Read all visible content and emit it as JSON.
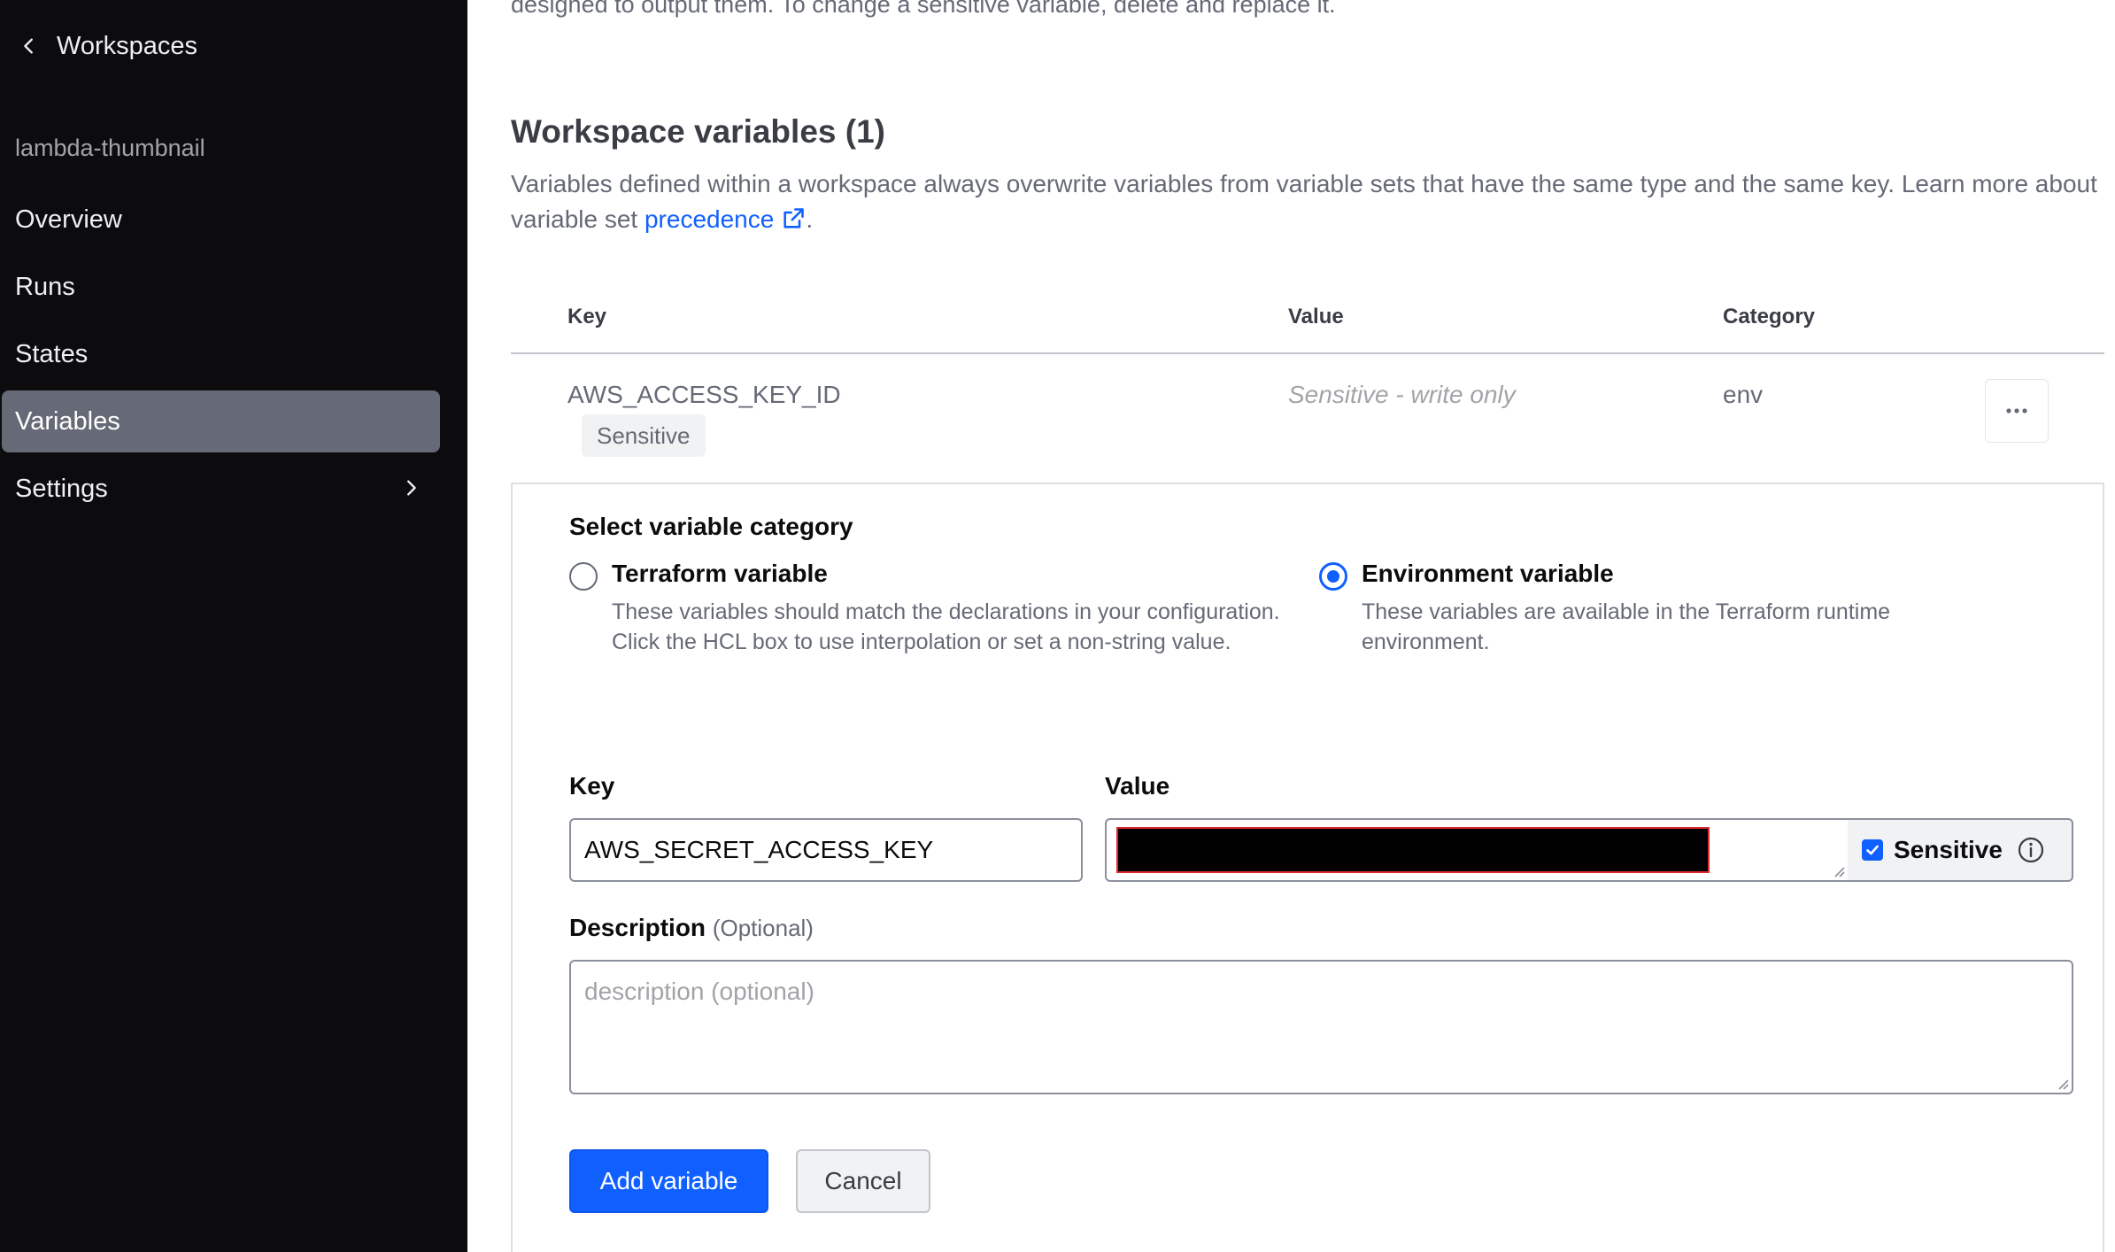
{
  "sidebar": {
    "back_label": "Workspaces",
    "workspace_name": "lambda-thumbnail",
    "items": [
      {
        "label": "Overview"
      },
      {
        "label": "Runs"
      },
      {
        "label": "States"
      },
      {
        "label": "Variables"
      },
      {
        "label": "Settings"
      }
    ],
    "active_item": "Variables"
  },
  "main": {
    "top_text": "designed to output them. To change a sensitive variable, delete and replace it.",
    "section_title": "Workspace variables (1)",
    "section_desc": "Variables defined within a workspace always overwrite variables from variable sets that have the same type and the same key. Learn more about variable set ",
    "precedence_link": "precedence",
    "desc_end": ".",
    "table": {
      "headers": {
        "key": "Key",
        "value": "Value",
        "category": "Category"
      },
      "rows": [
        {
          "key": "AWS_ACCESS_KEY_ID",
          "badge": "Sensitive",
          "value": "Sensitive - write only",
          "category": "env"
        }
      ]
    },
    "form": {
      "category_title": "Select variable category",
      "options": [
        {
          "label": "Terraform variable",
          "desc": "These variables should match the declarations in your configuration. Click the HCL box to use interpolation or set a non-string value.",
          "checked": false
        },
        {
          "label": "Environment variable",
          "desc": "These variables are available in the Terraform runtime environment.",
          "checked": true
        }
      ],
      "key_label": "Key",
      "key_value": "AWS_SECRET_ACCESS_KEY",
      "value_label": "Value",
      "sensitive_label": "Sensitive",
      "sensitive_checked": true,
      "description_label": "Description",
      "description_optional": "(Optional)",
      "description_placeholder": "description (optional)",
      "add_button": "Add variable",
      "cancel_button": "Cancel"
    }
  },
  "colors": {
    "sidebar_bg": "#0c0c0e",
    "active_nav": "#656a76",
    "accent": "#1060ff",
    "redaction": "#000000",
    "redaction_border": "#e0282f"
  }
}
